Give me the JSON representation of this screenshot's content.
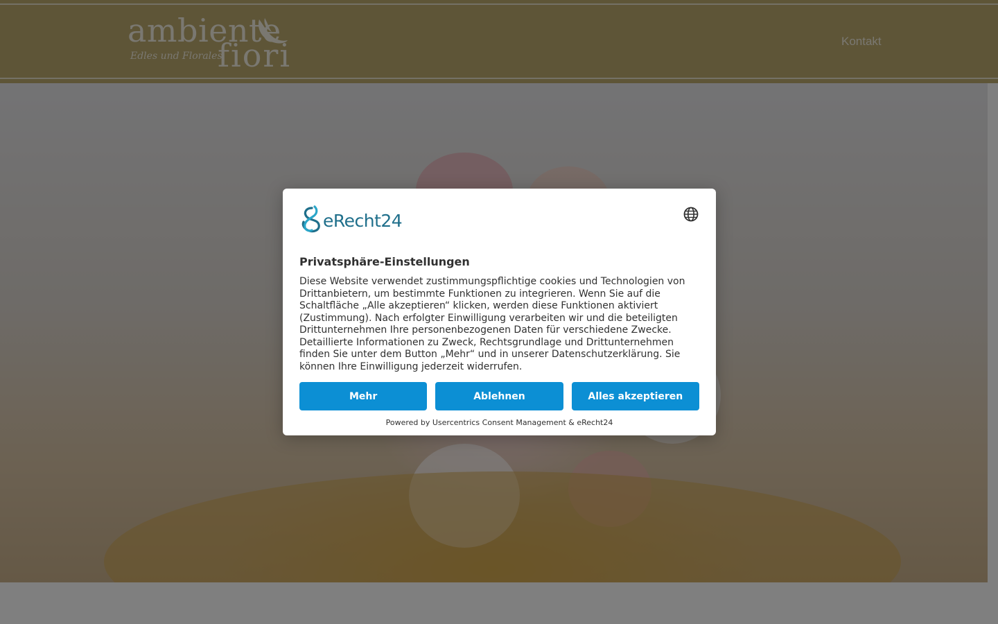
{
  "site": {
    "logo": {
      "word1": "ambiente",
      "word2": "fiori",
      "tagline": "Edles und Florales"
    },
    "nav": {
      "kontakt": "Kontakt"
    },
    "colors": {
      "header_bg": "#bcaa6f",
      "header_text": "#f4f0e3"
    }
  },
  "consent": {
    "brand_name": "eRecht24",
    "language_icon": "globe-icon",
    "title": "Privatsphäre-Einstellungen",
    "body": "Diese Website verwendet zustimmungspflichtige cookies und Technologien von Drittanbietern, um bestimmte Funktionen zu integrieren. Wenn Sie auf die Schaltfläche „Alle akzeptieren“ klicken, werden diese Funktionen aktiviert (Zustimmung). Nach erfolgter Einwilligung verarbeiten wir und die beteiligten Drittunternehmen Ihre personenbezogenen Daten für verschiedene Zwecke. Detaillierte Informationen zu Zweck, Rechtsgrundlage und Drittunternehmen finden Sie unter dem Button „Mehr“ und in unserer Datenschutzerklärung. Sie können Ihre Einwilligung jederzeit widerrufen.",
    "buttons": {
      "more": "Mehr",
      "decline": "Ablehnen",
      "accept_all": "Alles akzeptieren"
    },
    "powered_by": "Powered by Usercentrics Consent Management & eRecht24",
    "colors": {
      "button_bg": "#0c8fd4",
      "button_text": "#ffffff",
      "brand": "#1f6f8b"
    }
  }
}
